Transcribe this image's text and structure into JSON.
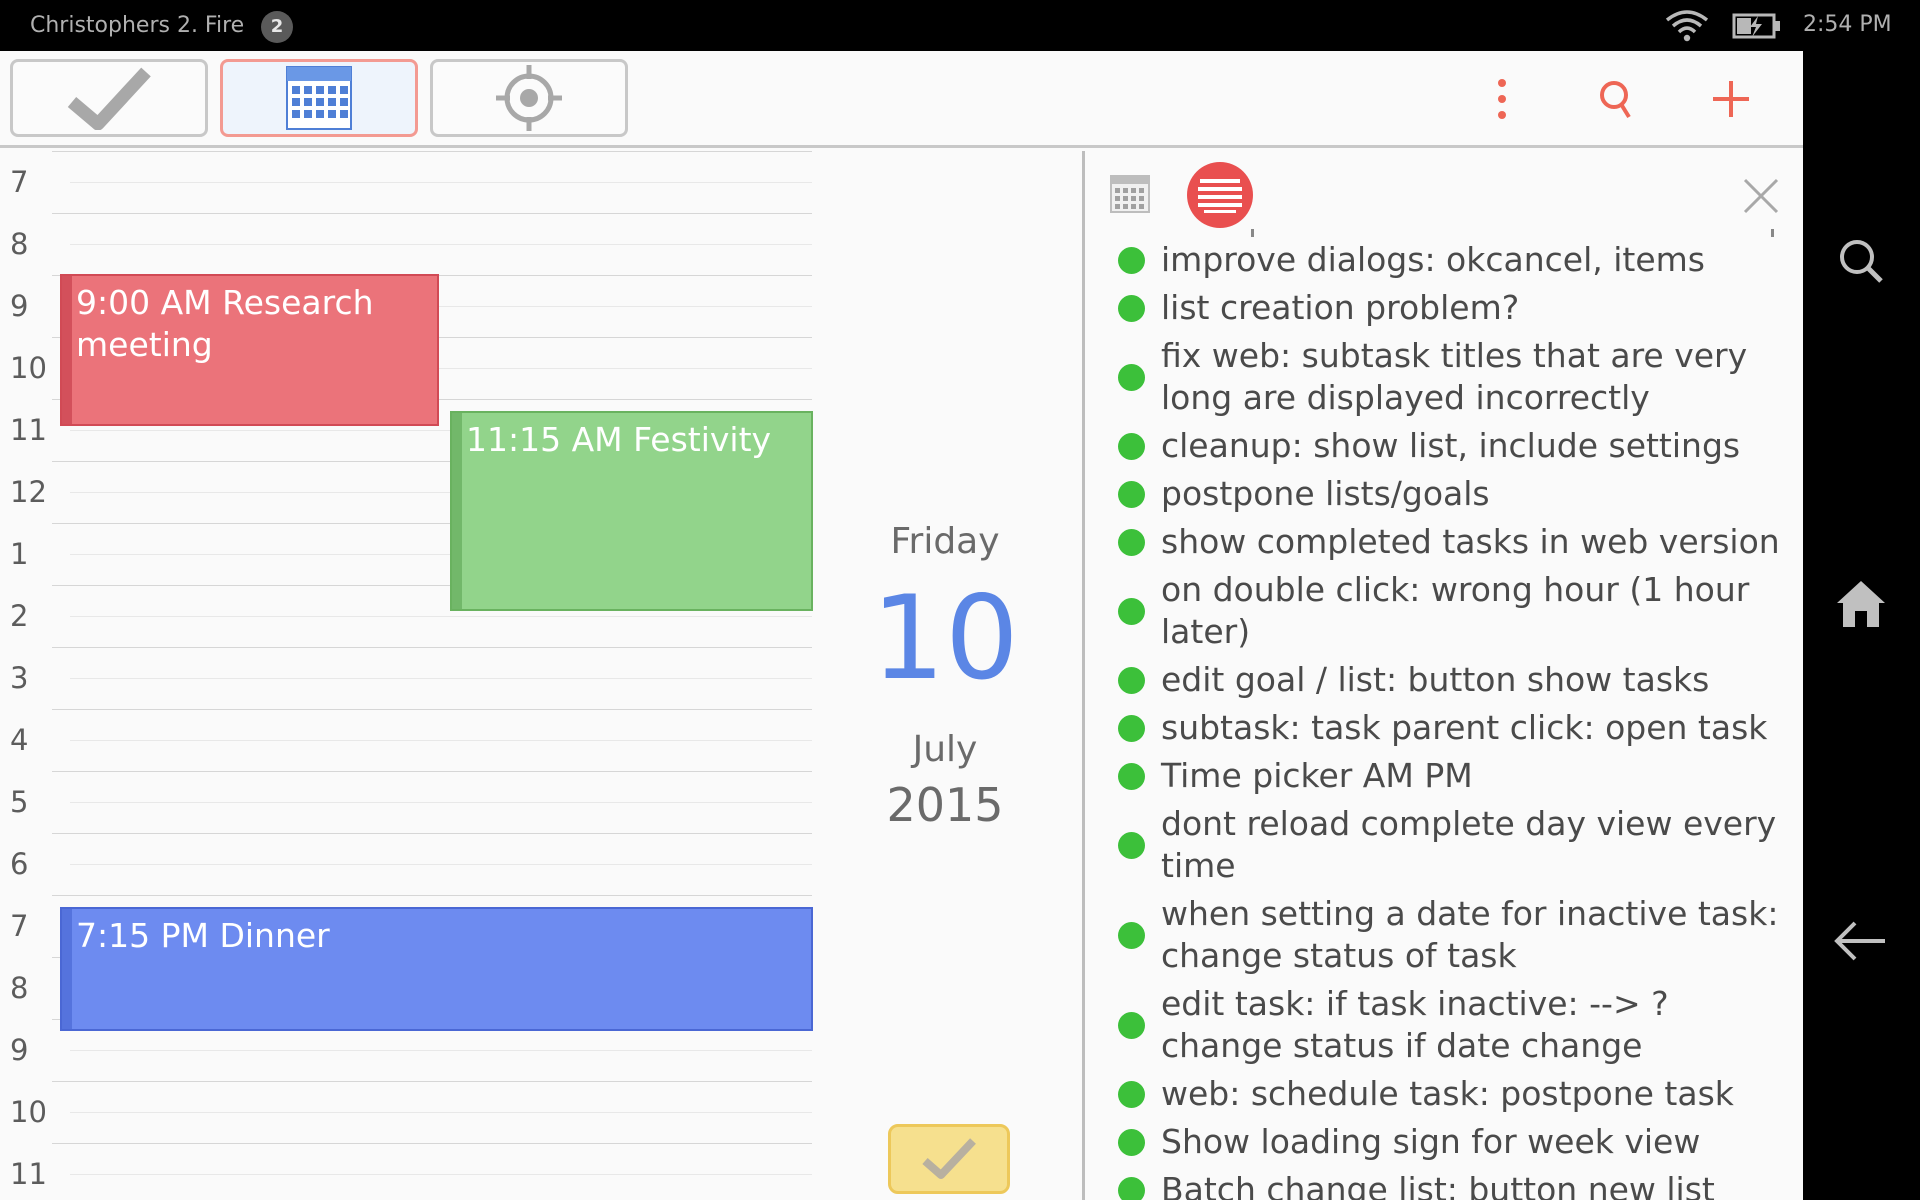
{
  "status_bar": {
    "title": "Christophers 2. Fire",
    "notification_count": "2",
    "time": "2:54 PM"
  },
  "toolbar": {
    "modes": [
      "tasks",
      "calendar",
      "goals"
    ],
    "active_mode": "calendar",
    "icons": [
      "checkmark-icon",
      "calendar-grid-icon",
      "target-icon",
      "overflow-menu-icon",
      "search-icon",
      "add-icon"
    ]
  },
  "day_view": {
    "hours": [
      "7",
      "8",
      "9",
      "10",
      "11",
      "12",
      "1",
      "2",
      "3",
      "4",
      "5",
      "6",
      "7",
      "8",
      "9",
      "10",
      "11"
    ],
    "events": [
      {
        "title": "9:00 AM Research meeting",
        "color": "#eb737a"
      },
      {
        "title": "11:15 AM Festivity",
        "color": "#92d48b"
      },
      {
        "title": "7:15 PM Dinner",
        "color": "#6d8bf0"
      }
    ]
  },
  "date_panel": {
    "weekday": "Friday",
    "day": "10",
    "month": "July",
    "year": "2015",
    "accent_color": "#5b86e5"
  },
  "task_panel": {
    "tasks": [
      "improve dialogs: okcancel, items",
      "list creation problem?",
      "fix web: subtask titles that are very long are displayed incorrectly",
      "cleanup: show list, include settings",
      "postpone lists/goals",
      "show completed tasks in web version",
      "on double click: wrong hour (1 hour later)",
      "edit goal / list: button show tasks",
      "subtask: task parent click: open task",
      "Time picker AM PM",
      "dont reload complete day view every time",
      "when setting a date for inactive task: change status of task",
      "edit task: if task inactive: --> ? change status if date change",
      "web: schedule task: postpone task",
      "Show loading sign for week view",
      "Batch change list: button new list"
    ],
    "status_color": "#3cc03a"
  }
}
